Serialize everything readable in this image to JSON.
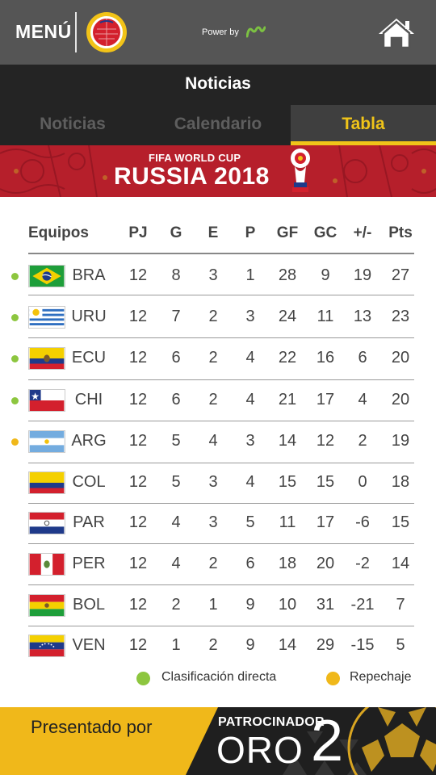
{
  "header": {
    "menu_label": "MENÚ",
    "powered_by": "Power by",
    "brand_color": "#555555"
  },
  "section": {
    "title": "Noticias"
  },
  "tabs": [
    {
      "label": "Noticias",
      "active": false
    },
    {
      "label": "Calendario",
      "active": false
    },
    {
      "label": "Tabla",
      "active": true
    }
  ],
  "banner": {
    "small_text": "FIFA WORLD CUP",
    "big_text": "RUSSIA 2018",
    "color": "#b61f2b"
  },
  "table": {
    "headers": {
      "team": "Equipos",
      "pj": "PJ",
      "g": "G",
      "e": "E",
      "p": "P",
      "gf": "GF",
      "gc": "GC",
      "diff": "+/-",
      "pts": "Pts"
    },
    "rows": [
      {
        "code": "BRA",
        "flag": "brazil-flag",
        "status": "direct",
        "pj": "12",
        "g": "8",
        "e": "3",
        "p": "1",
        "gf": "28",
        "gc": "9",
        "diff": "19",
        "pts": "27"
      },
      {
        "code": "URU",
        "flag": "uruguay-flag",
        "status": "direct",
        "pj": "12",
        "g": "7",
        "e": "2",
        "p": "3",
        "gf": "24",
        "gc": "11",
        "diff": "13",
        "pts": "23"
      },
      {
        "code": "ECU",
        "flag": "ecuador-flag",
        "status": "direct",
        "pj": "12",
        "g": "6",
        "e": "2",
        "p": "4",
        "gf": "22",
        "gc": "16",
        "diff": "6",
        "pts": "20"
      },
      {
        "code": "CHI",
        "flag": "chile-flag",
        "status": "direct",
        "pj": "12",
        "g": "6",
        "e": "2",
        "p": "4",
        "gf": "21",
        "gc": "17",
        "diff": "4",
        "pts": "20"
      },
      {
        "code": "ARG",
        "flag": "argentina-flag",
        "status": "playoff",
        "pj": "12",
        "g": "5",
        "e": "4",
        "p": "3",
        "gf": "14",
        "gc": "12",
        "diff": "2",
        "pts": "19"
      },
      {
        "code": "COL",
        "flag": "colombia-flag",
        "status": "none",
        "pj": "12",
        "g": "5",
        "e": "3",
        "p": "4",
        "gf": "15",
        "gc": "15",
        "diff": "0",
        "pts": "18"
      },
      {
        "code": "PAR",
        "flag": "paraguay-flag",
        "status": "none",
        "pj": "12",
        "g": "4",
        "e": "3",
        "p": "5",
        "gf": "11",
        "gc": "17",
        "diff": "-6",
        "pts": "15"
      },
      {
        "code": "PER",
        "flag": "peru-flag",
        "status": "none",
        "pj": "12",
        "g": "4",
        "e": "2",
        "p": "6",
        "gf": "18",
        "gc": "20",
        "diff": "-2",
        "pts": "14"
      },
      {
        "code": "BOL",
        "flag": "bolivia-flag",
        "status": "none",
        "pj": "12",
        "g": "2",
        "e": "1",
        "p": "9",
        "gf": "10",
        "gc": "31",
        "diff": "-21",
        "pts": "7"
      },
      {
        "code": "VEN",
        "flag": "venezuela-flag",
        "status": "none",
        "pj": "12",
        "g": "1",
        "e": "2",
        "p": "9",
        "gf": "14",
        "gc": "29",
        "diff": "-15",
        "pts": "5"
      }
    ]
  },
  "legend": {
    "direct_label": "Clasificación directa",
    "playoff_label": "Repechaje",
    "direct_color": "#8dc63f",
    "playoff_color": "#f0b81a"
  },
  "footer": {
    "presented_by": "Presentado por",
    "sponsor_small": "PATROCINADOR",
    "sponsor_big": "ORO",
    "sponsor_num": "2"
  }
}
